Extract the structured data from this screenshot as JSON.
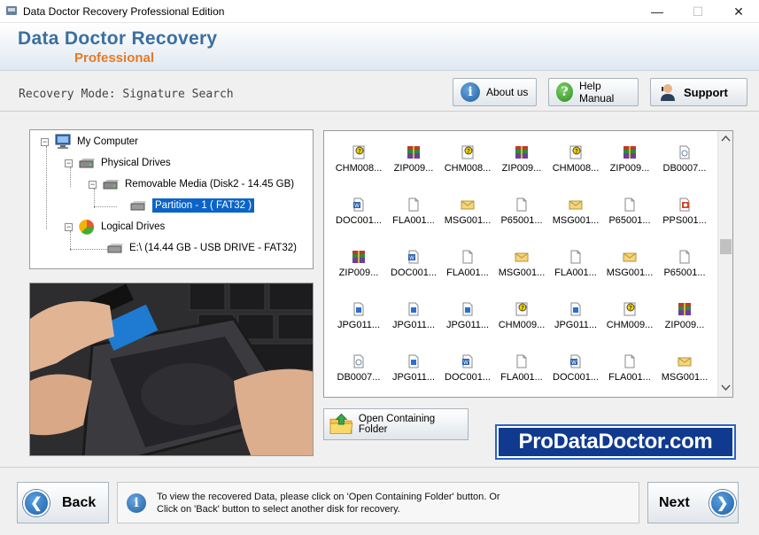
{
  "window": {
    "title": "Data Doctor Recovery Professional Edition",
    "controls": {
      "minimize": "—",
      "maximize": "☐",
      "close": "✕"
    }
  },
  "header": {
    "brand": "Data Doctor Recovery",
    "edition": "Professional"
  },
  "mode_bar": {
    "mode_text": "Recovery Mode: Signature Search",
    "about_label": "About us",
    "help_label": "Help Manual",
    "support_label": "Support"
  },
  "tree": {
    "root": "My Computer",
    "physical": "Physical Drives",
    "removable": "Removable Media (Disk2 - 14.45 GB)",
    "partition": "Partition - 1 ( FAT32 )",
    "logical": "Logical Drives",
    "drive_e": "E:\\ (14.44 GB - USB DRIVE - FAT32)"
  },
  "files": [
    {
      "name": "CHM008...",
      "icon": "chm-icon"
    },
    {
      "name": "ZIP009...",
      "icon": "zip-icon"
    },
    {
      "name": "CHM008...",
      "icon": "chm-icon"
    },
    {
      "name": "ZIP009...",
      "icon": "zip-icon"
    },
    {
      "name": "CHM008...",
      "icon": "chm-icon"
    },
    {
      "name": "ZIP009...",
      "icon": "zip-icon"
    },
    {
      "name": "DB0007...",
      "icon": "db-icon"
    },
    {
      "name": "DOC001...",
      "icon": "doc-icon"
    },
    {
      "name": "FLA001...",
      "icon": "blank-icon"
    },
    {
      "name": "MSG001...",
      "icon": "msg-icon"
    },
    {
      "name": "P65001...",
      "icon": "blank-icon"
    },
    {
      "name": "MSG001...",
      "icon": "msg-icon"
    },
    {
      "name": "P65001...",
      "icon": "blank-icon"
    },
    {
      "name": "PPS001...",
      "icon": "pps-icon"
    },
    {
      "name": "ZIP009...",
      "icon": "zip-icon"
    },
    {
      "name": "DOC001...",
      "icon": "doc-icon"
    },
    {
      "name": "FLA001...",
      "icon": "blank-icon"
    },
    {
      "name": "MSG001...",
      "icon": "msg-icon"
    },
    {
      "name": "FLA001...",
      "icon": "blank-icon"
    },
    {
      "name": "MSG001...",
      "icon": "msg-icon"
    },
    {
      "name": "P65001...",
      "icon": "blank-icon"
    },
    {
      "name": "JPG011...",
      "icon": "jpg-icon"
    },
    {
      "name": "JPG011...",
      "icon": "jpg-icon"
    },
    {
      "name": "JPG011...",
      "icon": "jpg-icon"
    },
    {
      "name": "CHM009...",
      "icon": "chm-icon"
    },
    {
      "name": "JPG011...",
      "icon": "jpg-icon"
    },
    {
      "name": "CHM009...",
      "icon": "chm-icon"
    },
    {
      "name": "ZIP009...",
      "icon": "zip-icon"
    },
    {
      "name": "DB0007...",
      "icon": "db-icon"
    },
    {
      "name": "JPG011...",
      "icon": "jpg-icon"
    },
    {
      "name": "DOC001...",
      "icon": "doc-icon"
    },
    {
      "name": "FLA001...",
      "icon": "blank-icon"
    },
    {
      "name": "DOC001...",
      "icon": "doc-icon"
    },
    {
      "name": "FLA001...",
      "icon": "blank-icon"
    },
    {
      "name": "MSG001...",
      "icon": "msg-icon"
    }
  ],
  "actions": {
    "open_folder": "Open Containing Folder",
    "back": "Back",
    "next": "Next"
  },
  "logo_text": "ProDataDoctor.com",
  "info": {
    "line1": "To view the recovered Data, please click on 'Open Containing Folder' button. Or",
    "line2": "Click on 'Back' button to select another disk for recovery."
  },
  "colors": {
    "brand": "#3b6fa1",
    "edition": "#e67a24",
    "selection": "#0a64c8",
    "logo_bg": "#0f3a8f"
  }
}
